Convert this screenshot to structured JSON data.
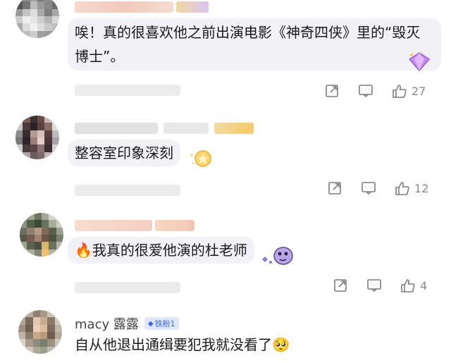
{
  "comments": [
    {
      "text": "唉！真的很喜欢他之前出演电影《神奇四侠》里的“毁灭博士”。",
      "likes": "27"
    },
    {
      "text": "整容室印象深刻",
      "likes": "12"
    },
    {
      "emoji": "🔥",
      "text": "我真的很爱他演的杜老师",
      "likes": "4"
    },
    {
      "username": "macy 露露",
      "badge": "铁粉1",
      "text": "自从他退出通缉要犯我就没看了",
      "emoji": "🥺"
    }
  ],
  "colors": {
    "badge_blue": "#3d63ff",
    "icon_gray": "#7d7d7d",
    "bubble_bg": "#f2f2f6"
  },
  "icons": [
    "share-icon",
    "comment-icon",
    "like-icon",
    "gem-sticker-icon",
    "star-sticker-icon",
    "monster-sticker-icon"
  ]
}
